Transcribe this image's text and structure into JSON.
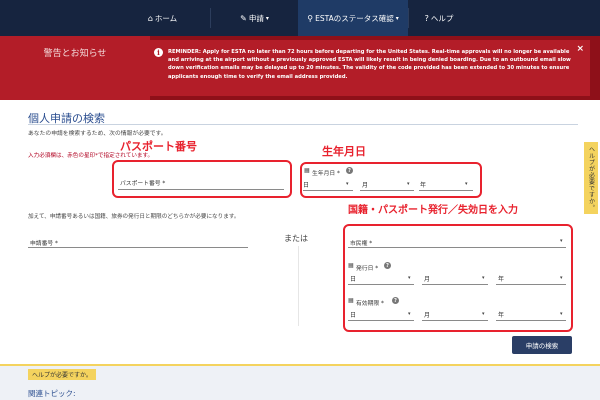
{
  "nav": {
    "items": [
      {
        "icon": "home-icon",
        "glyph": "⌂",
        "label": "ホーム",
        "caret": false
      },
      {
        "icon": "pencil-icon",
        "glyph": "✎",
        "label": "申請",
        "caret": true
      },
      {
        "icon": "search-icon",
        "glyph": "⚲",
        "label": "ESTAのステータス確認",
        "caret": true
      },
      {
        "icon": "help-icon",
        "glyph": "?",
        "label": "ヘルプ",
        "caret": false
      }
    ],
    "active_index": 2,
    "colors": {
      "background": "#16243f",
      "active": "#1f3b66"
    }
  },
  "alert": {
    "sidebar_title": "警告とお知らせ",
    "icon": "info-icon",
    "close_label": "×",
    "text": "REMINDER: Apply for ESTA no later than 72 hours before departing for the United States. Real-time approvals will no longer be available and arriving at the airport without a previously approved ESTA will likely result in being denied boarding. Due to an outbound email slow down verification emails may be delayed up to 20 minutes. The validity of the code provided has been extended to 30 minutes to ensure applicants enough time to verify the email address provided.",
    "colors": {
      "dark": "#8e1019",
      "accent": "#b31d28"
    }
  },
  "main": {
    "title": "個人申請の検索",
    "intro": "あなたの申請を検索するため、次の情報が必要です。",
    "required_note": "入力必須欄は、赤色の星印*で指定されています。",
    "hint": "加えて、申請番号あるいは国籍、旅券の発行日と期限のどちらかが必要になります。",
    "or_label": "または",
    "search_button": "申請の検索"
  },
  "annotations": {
    "passport": "パスポート番号",
    "dob": "生年月日",
    "nationality": "国籍・パスポート発行／失効日を入力",
    "color": "#e8222e"
  },
  "form": {
    "passport_label": "パスポート番号 *",
    "dob_label": "生年月日 *",
    "application_label": "申請番号 *",
    "citizenship_label": "市民権 *",
    "issue_label": "発行日 *",
    "expiry_label": "有効期限 *",
    "day": "日",
    "month": "月",
    "year": "年"
  },
  "side_tab": "ヘルプが必要ですか。",
  "footer": {
    "help_tag": "ヘルプが必要ですか。",
    "related": "関連トピック:"
  }
}
